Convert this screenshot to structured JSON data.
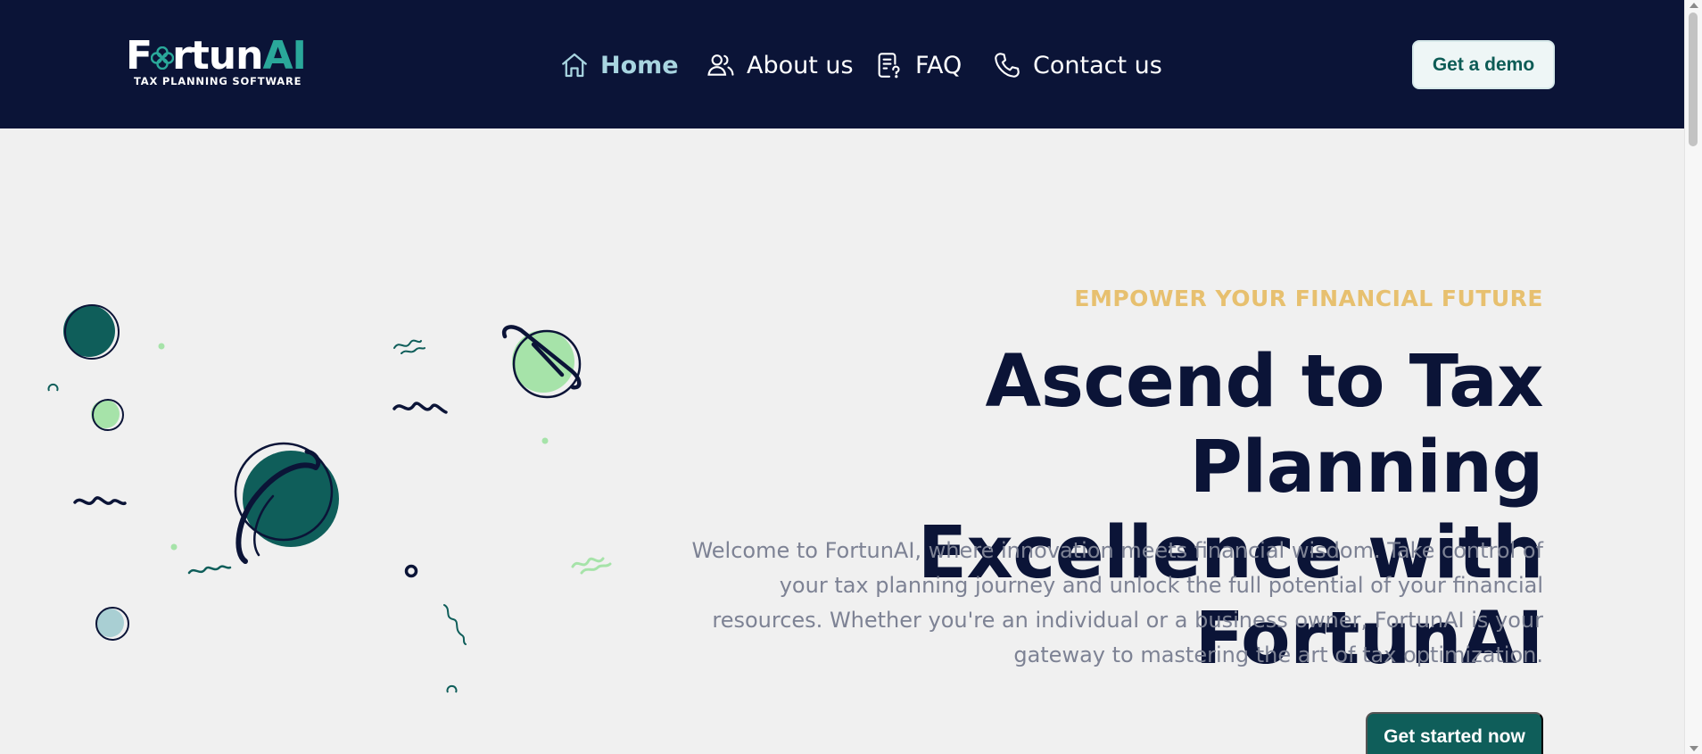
{
  "brand": {
    "name_prefix": "F",
    "name_middle": "rtun",
    "name_ai": "AI",
    "tagline": "TAX PLANNING SOFTWARE"
  },
  "nav": {
    "items": [
      {
        "label": "Home",
        "icon": "home-icon",
        "active": true
      },
      {
        "label": "About us",
        "icon": "users-icon",
        "active": false
      },
      {
        "label": "FAQ",
        "icon": "faq-document-icon",
        "active": false
      },
      {
        "label": "Contact us",
        "icon": "phone-icon",
        "active": false
      }
    ],
    "demo_label": "Get a demo"
  },
  "hero": {
    "eyebrow": "EMPOWER YOUR FINANCIAL FUTURE",
    "headline_line1": "Ascend to Tax Planning",
    "headline_line2": "Excellence with FortunAI",
    "intro": "Welcome to FortunAI, where innovation meets financial wisdom. Take control of your tax planning journey and unlock the full potential of your financial resources. Whether you're an individual or a business owner, FortunAI is your gateway to mastering the art of tax optimization.",
    "cta_label": "Get started now"
  },
  "colors": {
    "header_bg": "#0b1437",
    "page_bg": "#f0f0f0",
    "accent_teal": "#0f5e5a",
    "accent_gold": "#e7c06f",
    "accent_mint": "#a6e3a9",
    "nav_active": "#a8d5e0"
  }
}
